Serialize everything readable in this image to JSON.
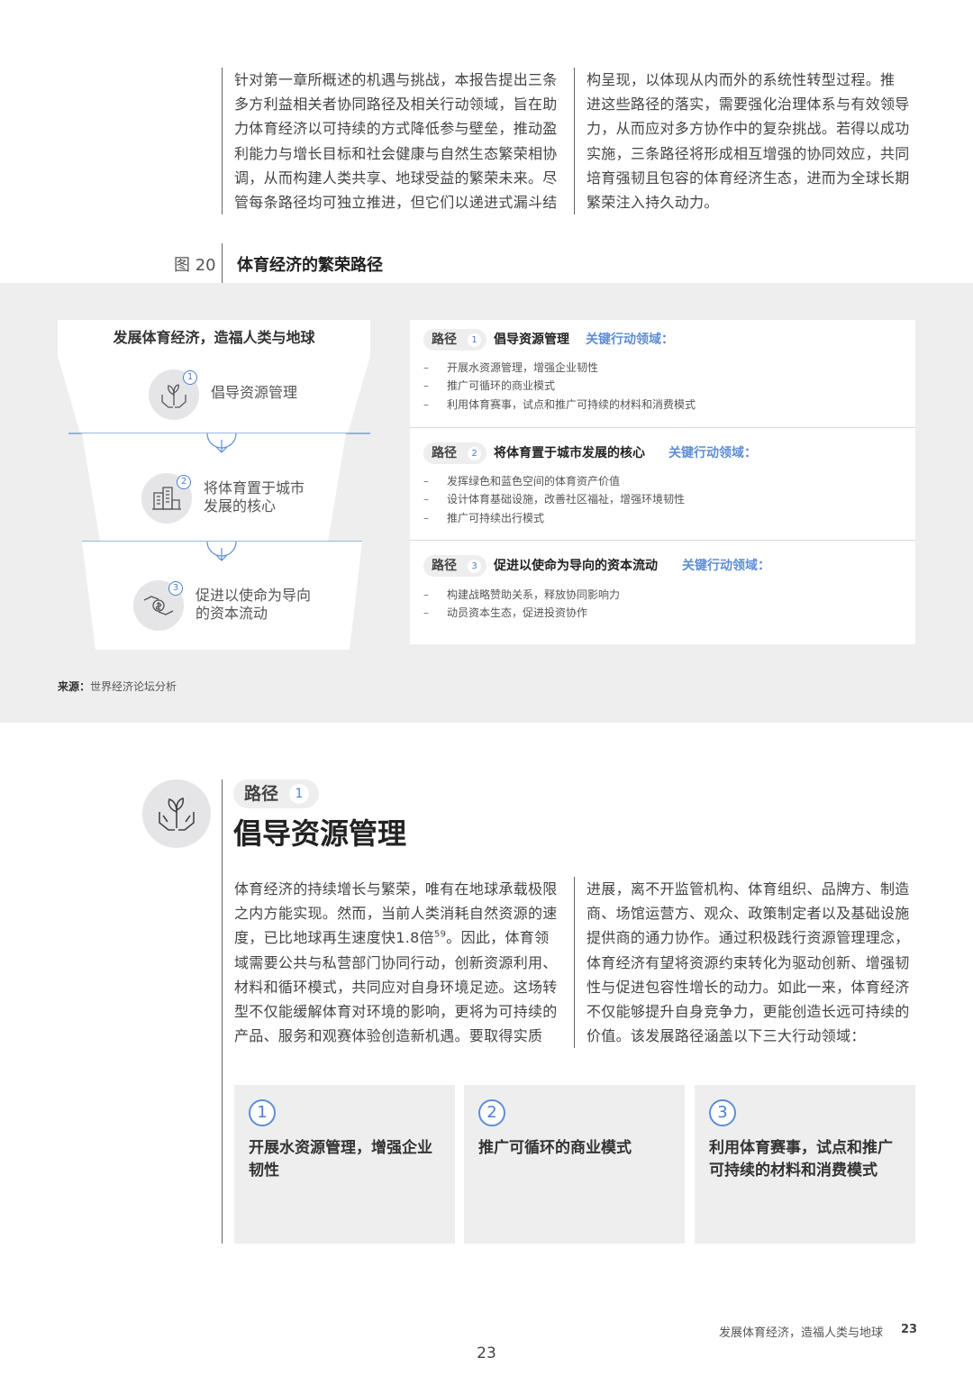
{
  "intro": {
    "col1": [
      "针对第一章所概述的机遇与挑战，本报告提出三条",
      "多方利益相关者协同路径及相关行动领域，旨在助",
      "力体育经济以可持续的方式降低参与壁垒，推动盈",
      "利能力与增长目标和社会健康与自然生态繁荣相协",
      "调，从而构建人类共享、地球受益的繁荣未来。尽",
      "管每条路径均可独立推进，但它们以递进式漏斗结"
    ],
    "col2": [
      "构呈现，以体现从内而外的系统性转型过程。推",
      "进这些路径的落实，需要强化治理体系与有效领导",
      "力，从而应对多方协作中的复杂挑战。若得以成功",
      "实施，三条路径将形成相互增强的协同效应，共同",
      "培育强韧且包容的体育经济生态，进而为全球长期",
      "繁荣注入持久动力。"
    ]
  },
  "figure": {
    "label": "图 20",
    "title": "体育经济的繁荣路径",
    "funnel_title": "发展体育经济，造福人类与地球",
    "steps": [
      {
        "num": "1",
        "icon": "plant-hands-icon",
        "line1": "倡导资源管理",
        "line2": ""
      },
      {
        "num": "2",
        "icon": "city-building-icon",
        "line1": "将体育置于城市",
        "line2": "发展的核心"
      },
      {
        "num": "3",
        "icon": "money-hands-icon",
        "line1": "促进以使命为导向",
        "line2": "的资本流动"
      }
    ],
    "paths": [
      {
        "pill": "路径",
        "num": "1",
        "title": "倡导资源管理",
        "key": "关键行动领域：",
        "bullets": [
          "开展水资源管理，增强企业韧性",
          "推广可循环的商业模式",
          "利用体育赛事，试点和推广可持续的材料和消费模式"
        ]
      },
      {
        "pill": "路径",
        "num": "2",
        "title": "将体育置于城市发展的核心",
        "key": "关键行动领域：",
        "bullets": [
          "发挥绿色和蓝色空间的体育资产价值",
          "设计体育基础设施，改善社区福祉，增强环境韧性",
          "推广可持续出行模式"
        ]
      },
      {
        "pill": "路径",
        "num": "3",
        "title": "促进以使命为导向的资本流动",
        "key": "关键行动领域：",
        "bullets": [
          "构建战略赞助关系，释放协同影响力",
          "动员资本生态，促进投资协作"
        ]
      }
    ],
    "source_label": "来源：",
    "source_text": "世界经济论坛分析",
    "bullet_dash": "–"
  },
  "section": {
    "pill": "路径",
    "num": "1",
    "title": "倡导资源管理",
    "icon": "plant-hands-icon",
    "col1": {
      "l1": "体育经济的持续增长与繁荣，唯有在地球承载极限",
      "l2": "之内方能实现。然而，当前人类消耗自然资源的速",
      "l3a": "度，已比地球再生速度快1.8倍",
      "l3sup": "59",
      "l3b": "。因此，体育领",
      "l4": "域需要公共与私营部门协同行动，创新资源利用、",
      "l5": "材料和循环模式，共同应对自身环境足迹。这场转",
      "l6": "型不仅能缓解体育对环境的影响，更将为可持续的",
      "l7": "产品、服务和观赛体验创造新机遇。要取得实质"
    },
    "col2": [
      "进展，离不开监管机构、体育组织、品牌方、制造",
      "商、场馆运营方、观众、政策制定者以及基础设施",
      "提供商的通力协作。通过积极践行资源管理理念，",
      "体育经济有望将资源约束转化为驱动创新、增强韧",
      "性与促进包容性增长的动力。如此一来，体育经济",
      "不仅能够提升自身竞争力，更能创造长远可持续的",
      "价值。该发展路径涵盖以下三大行动领域："
    ],
    "cards": [
      {
        "num": "1",
        "title": "开展水资源管理，增强企业韧性"
      },
      {
        "num": "2",
        "title": "推广可循环的商业模式"
      },
      {
        "num": "3",
        "title": "利用体育赛事，试点和推广可持续的材料和消费模式"
      }
    ]
  },
  "footer": {
    "running_title": "发展体育经济，造福人类与地球",
    "running_page": "23",
    "page_number": "23"
  },
  "colors": {
    "accent": "#5e8ed6",
    "band": "#eeeeef",
    "icon_bg": "#e5e5e7"
  }
}
